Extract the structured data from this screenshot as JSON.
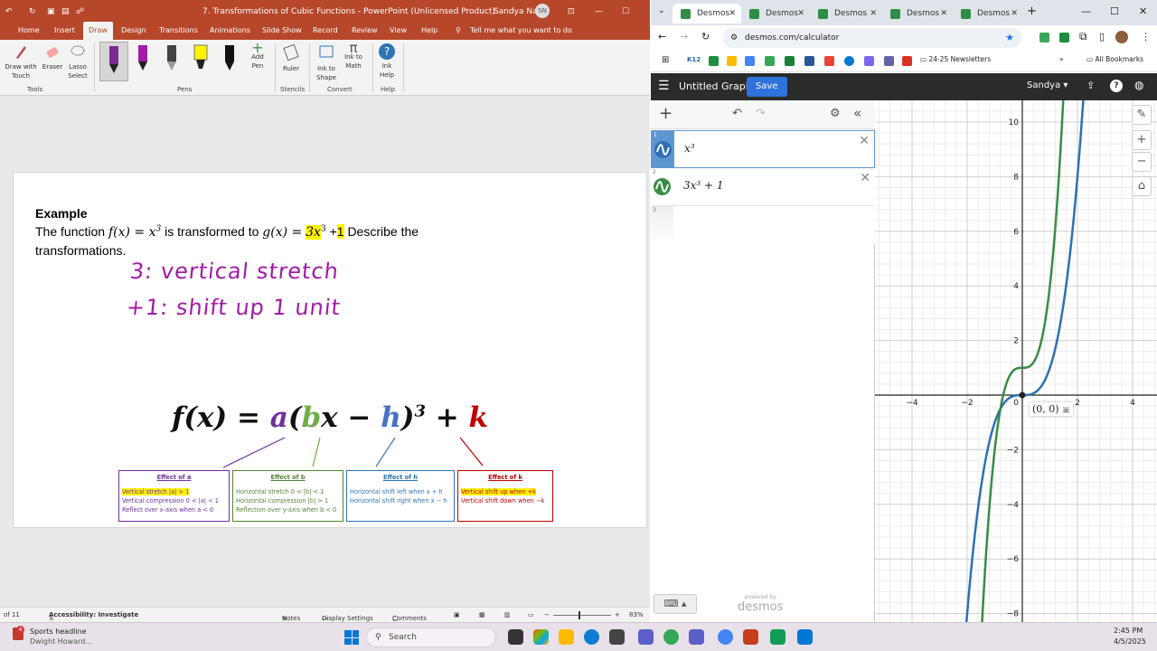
{
  "ppt": {
    "title": "7. Transformations of Cubic Functions  -  PowerPoint (Unlicensed Product)",
    "user": "Sandya Nair",
    "user_initials": "SN",
    "tabs": [
      "Home",
      "Insert",
      "Draw",
      "Design",
      "Transitions",
      "Animations",
      "Slide Show",
      "Record",
      "Review",
      "View",
      "Help"
    ],
    "tell_me": "Tell me what you want to do",
    "ribbon": {
      "draw_with_touch": "Draw with Touch",
      "eraser": "Eraser",
      "lasso_select": "Lasso Select",
      "add_pen": "Add Pen",
      "ruler": "Ruler",
      "ink_to_shape": "Ink to Shape",
      "ink_to_math": "Ink to Math",
      "ink_help": "Ink Help",
      "groups": {
        "tools": "Tools",
        "pens": "Pens",
        "stencils": "Stencils",
        "convert": "Convert",
        "help": "Help"
      }
    },
    "slide": {
      "heading": "Example",
      "line1_a": "The function",
      "fx": "f(x) = x",
      "line1_b": "is transformed to",
      "gx": "g(x) =",
      "g_a": "3x",
      "g_plus": "+",
      "g_k": "1",
      "line1_c": "Describe the",
      "line2": "transformations.",
      "ink1": "3: vertical stretch",
      "ink2": "+1: shift up 1 unit",
      "formula": {
        "f": "f(x) = ",
        "a": "a",
        "p1": "(",
        "b": "b",
        "x": "x − ",
        "h": "h",
        "p2": ")",
        "exp": "3",
        "plus": " + ",
        "k": "k"
      },
      "effects": [
        {
          "title": "Effect of a",
          "color": "#7030a0",
          "lines": [
            "Vertical stretch |a| > 1",
            "Vertical compression 0 < |a| < 1",
            "Reflect over x-axis when a < 0"
          ]
        },
        {
          "title": "Effect of b",
          "color": "#548235",
          "lines": [
            "Horizontal stretch 0 < |b| < 1",
            "Horizontal compression |b| > 1",
            "Reflection over y-axis when b < 0"
          ]
        },
        {
          "title": "Effect of h",
          "color": "#2e75b6",
          "lines": [
            "Horizontal shift left when x + h",
            "Horizontal shift right when x − h"
          ]
        },
        {
          "title": "Effect of k",
          "color": "#c00000",
          "lines": [
            "Vertical shift up when +k",
            "Vertical shift down when −k"
          ]
        }
      ]
    },
    "status": {
      "slide": "of 11",
      "accessibility": "Accessibility: Investigate",
      "notes": "Notes",
      "display_settings": "Display Settings",
      "comments": "Comments",
      "zoom": "83%"
    }
  },
  "chrome": {
    "tabs": [
      "Desmos",
      "Desmos",
      "Desmos",
      "Desmos",
      "Desmos"
    ],
    "url": "desmos.com/calculator",
    "bookmarks": {
      "folder": "24-25 Newsletters",
      "all": "All Bookmarks",
      "k12": "K12"
    }
  },
  "desmos": {
    "graph_title": "Untitled Graph",
    "save": "Save",
    "user": "Sandya",
    "expressions": [
      {
        "index": "1",
        "latex": "x³",
        "color": "#2d70b3"
      },
      {
        "index": "2",
        "latex": "3x³ + 1",
        "color": "#388c46"
      },
      {
        "index": "3",
        "latex": "",
        "color": ""
      }
    ],
    "point_label": "(0, 0)",
    "powered": "powered by",
    "brand": "desmos",
    "x_ticks": [
      "-4",
      "-2",
      "0",
      "2",
      "4"
    ],
    "y_ticks": [
      "10",
      "8",
      "6",
      "4",
      "2",
      "-2",
      "-4",
      "-6",
      "-8"
    ]
  },
  "taskbar": {
    "news_title": "Sports headline",
    "news_sub": "Dwight Howard...",
    "search": "Search",
    "time": "2:45 PM",
    "date": "4/5/2025",
    "badge": "4"
  },
  "colors": {
    "ppt": "#b7472a",
    "desmos_blue": "#2d70b3",
    "desmos_green": "#388c46",
    "highlight": "#fff200",
    "ink": "#a11aa8"
  }
}
